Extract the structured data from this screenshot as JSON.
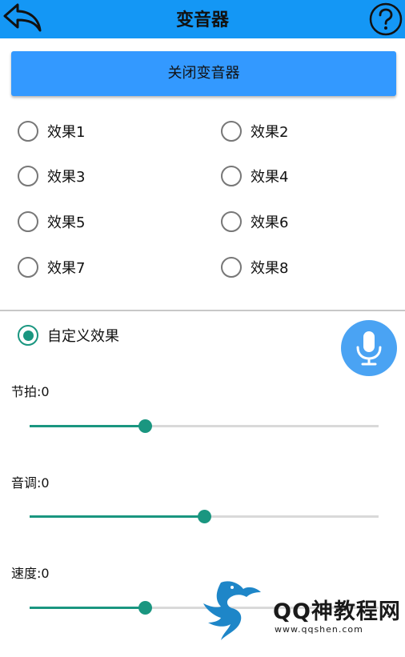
{
  "header": {
    "title": "变音器",
    "back_icon": "back-arrow-icon",
    "help_icon": "help-circle-icon",
    "color": "#1497f5"
  },
  "close_button": {
    "label": "关闭变音器"
  },
  "effects": [
    {
      "label": "效果1",
      "selected": false
    },
    {
      "label": "效果2",
      "selected": false
    },
    {
      "label": "效果3",
      "selected": false
    },
    {
      "label": "效果4",
      "selected": false
    },
    {
      "label": "效果5",
      "selected": false
    },
    {
      "label": "效果6",
      "selected": false
    },
    {
      "label": "效果7",
      "selected": false
    },
    {
      "label": "效果8",
      "selected": false
    }
  ],
  "custom": {
    "label": "自定义效果",
    "selected": true,
    "mic_icon": "microphone-icon"
  },
  "sliders": [
    {
      "label": "节拍:0",
      "value": 0.33
    },
    {
      "label": "音调:0",
      "value": 0.5
    },
    {
      "label": "速度:0",
      "value": 0.33
    }
  ],
  "watermark": {
    "text": "QQ神教程网",
    "url": "www.qqshen.com"
  },
  "colors": {
    "accent": "#1a9680",
    "button": "#3399ff",
    "mic": "#4aa3f3"
  }
}
